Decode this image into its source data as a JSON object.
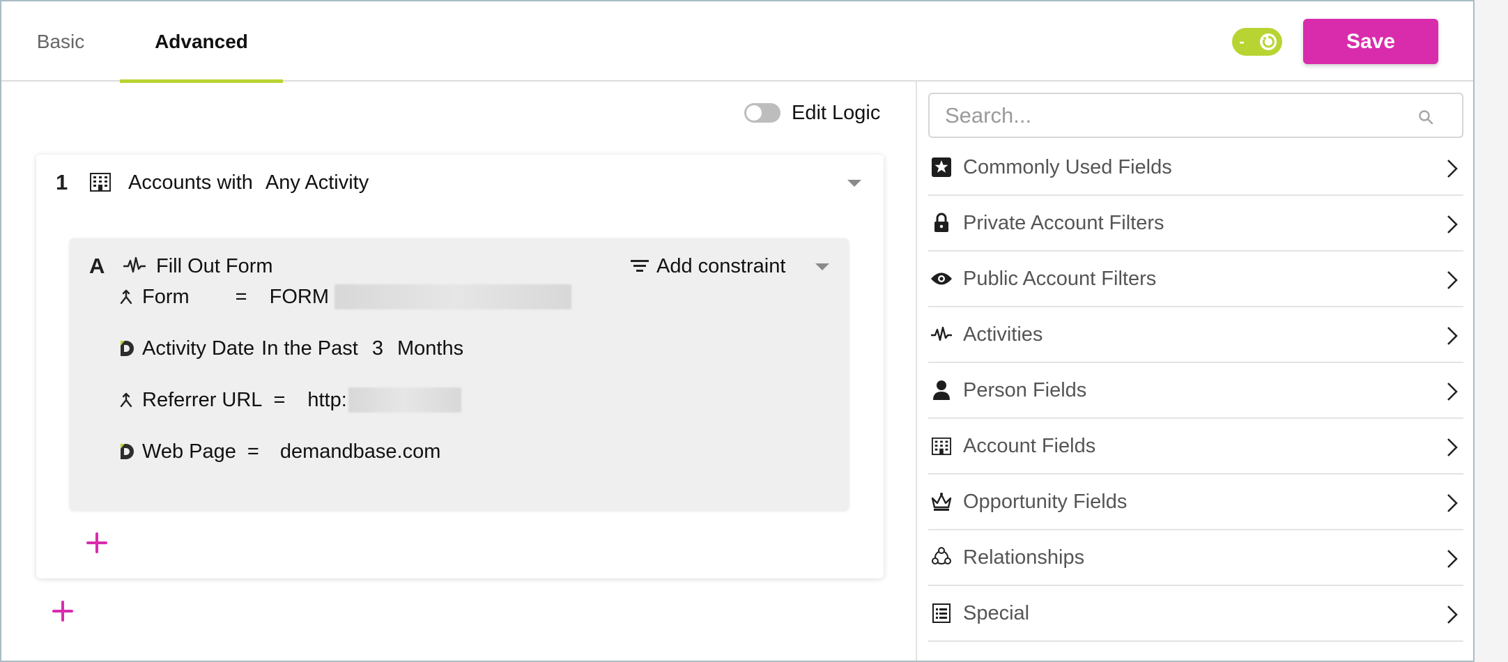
{
  "header": {
    "tabs": [
      {
        "label": "Basic",
        "active": false
      },
      {
        "label": "Advanced",
        "active": true
      }
    ],
    "toggle_text": "-",
    "save_label": "Save"
  },
  "colors": {
    "accent_green": "#b8d432",
    "accent_magenta": "#d92cad"
  },
  "builder": {
    "edit_logic_label": "Edit Logic",
    "edit_logic_on": false,
    "group": {
      "number": "1",
      "icon": "building-icon",
      "title": "Accounts with",
      "qualifier": "Any Activity",
      "constraint_block": {
        "letter": "A",
        "icon": "pulse-icon",
        "title": "Fill Out Form",
        "add_constraint_label": "Add constraint",
        "rows": [
          {
            "icon": "merge-arrow-icon",
            "field": "Form",
            "op": "=",
            "value": "FORM"
          },
          {
            "icon": "demandbase-d-icon",
            "field": "Activity Date",
            "op": "In the Past",
            "value": "3",
            "unit": "Months"
          },
          {
            "icon": "merge-arrow-icon",
            "field": "Referrer URL",
            "op": "=",
            "value": "http:"
          },
          {
            "icon": "demandbase-d-icon",
            "field": "Web Page",
            "op": "=",
            "value": "demandbase.com"
          }
        ]
      }
    }
  },
  "sidebar": {
    "search_placeholder": "Search...",
    "categories": [
      {
        "label": "Commonly Used Fields",
        "icon": "star-box-icon"
      },
      {
        "label": "Private Account Filters",
        "icon": "lock-icon"
      },
      {
        "label": "Public Account Filters",
        "icon": "eye-icon"
      },
      {
        "label": "Activities",
        "icon": "pulse-icon"
      },
      {
        "label": "Person Fields",
        "icon": "person-icon"
      },
      {
        "label": "Account Fields",
        "icon": "building-icon"
      },
      {
        "label": "Opportunity Fields",
        "icon": "crown-icon"
      },
      {
        "label": "Relationships",
        "icon": "network-icon"
      },
      {
        "label": "Special",
        "icon": "list-icon"
      }
    ]
  }
}
